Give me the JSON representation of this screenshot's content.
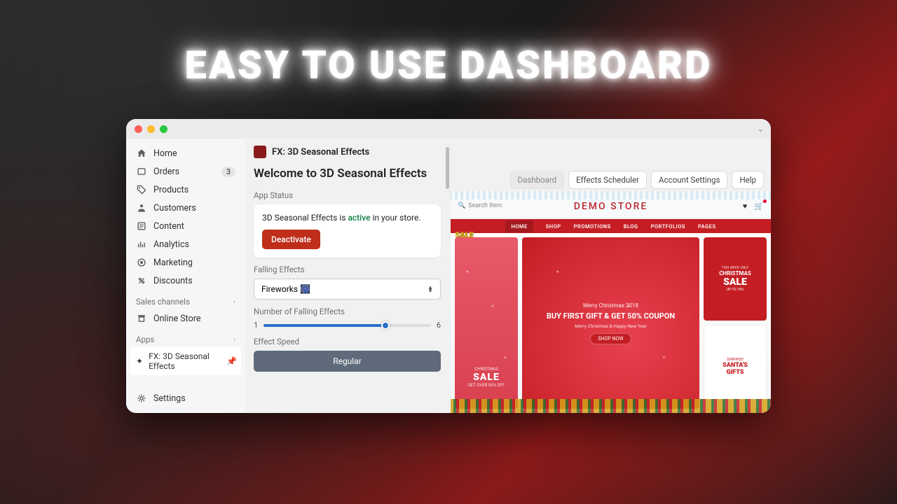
{
  "hero": "EASY TO USE DASHBOARD",
  "sidebar": {
    "items": [
      {
        "icon": "home",
        "label": "Home"
      },
      {
        "icon": "orders",
        "label": "Orders",
        "badge": "3"
      },
      {
        "icon": "tag",
        "label": "Products"
      },
      {
        "icon": "user",
        "label": "Customers"
      },
      {
        "icon": "content",
        "label": "Content"
      },
      {
        "icon": "analytics",
        "label": "Analytics"
      },
      {
        "icon": "marketing",
        "label": "Marketing"
      },
      {
        "icon": "discount",
        "label": "Discounts"
      }
    ],
    "channels_label": "Sales channels",
    "channels": [
      {
        "icon": "store",
        "label": "Online Store"
      }
    ],
    "apps_label": "Apps",
    "apps": [
      {
        "icon": "fx",
        "label": "FX: 3D Seasonal Effects"
      }
    ],
    "settings": {
      "icon": "gear",
      "label": "Settings"
    }
  },
  "header": {
    "app_name": "FX: 3D Seasonal Effects"
  },
  "main": {
    "welcome": "Welcome to 3D Seasonal Effects",
    "tabs": [
      "Dashboard",
      "Effects Scheduler",
      "Account Settings",
      "Help"
    ],
    "app_status_label": "App Status",
    "status_prefix": "3D Seasonal Effects is ",
    "status_word": "active",
    "status_suffix": " in your store.",
    "deactivate": "Deactivate",
    "falling_label": "Falling Effects",
    "falling_value": "Fireworks 🎆",
    "count_label": "Number of Falling Effects",
    "count_min": "1",
    "count_max": "6",
    "speed_label": "Effect Speed",
    "speed_value": "Regular"
  },
  "preview": {
    "search": "Search Item",
    "store": "DEMO STORE",
    "nav": [
      "HOME",
      "SHOP",
      "PROMOTIONS",
      "BLOG",
      "PORTFOLIOS",
      "PAGES"
    ],
    "left": {
      "t1": "CHRISTMAS",
      "t2": "SALE",
      "t3": "GET OVER 50% OFF"
    },
    "center": {
      "t1": "Merry Christmas 2018",
      "t2": "BUY FIRST GIFT & GET 50% COUPON",
      "t3": "Merry Christmas & Happy New Year",
      "btn": "SHOP NOW"
    },
    "right1": {
      "t1": "THIS WEEK ONLY",
      "t2": "CHRISTMAS",
      "t3": "SALE",
      "t4": "UP TO 70%"
    },
    "right2": {
      "t1": "SURPRISE!",
      "t2": "SANTA'S",
      "t3": "GIFTS"
    },
    "sale_badge": "SALE"
  }
}
